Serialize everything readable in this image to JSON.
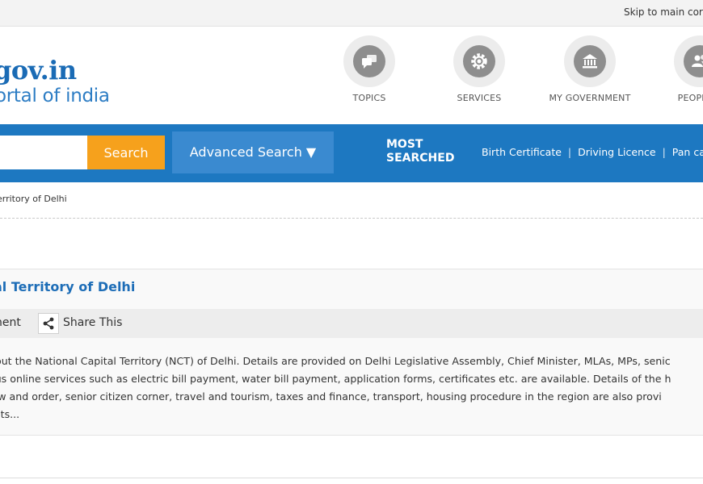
{
  "skip_link": "Skip to main cor",
  "logo": {
    "main": "gov.in",
    "sub": "ortal of india"
  },
  "nav": [
    {
      "label": "TOPICS",
      "icon": "topics-icon"
    },
    {
      "label": "SERVICES",
      "icon": "services-icon"
    },
    {
      "label": "MY GOVERNMENT",
      "icon": "government-icon"
    },
    {
      "label": "PEOPLE C",
      "icon": "people-icon"
    }
  ],
  "search": {
    "placeholder": "",
    "button": "Search",
    "advanced": "Advanced Search ▼"
  },
  "most_searched": {
    "line1": "MOST",
    "line2": "SEARCHED"
  },
  "quick_links": [
    "Birth Certificate",
    "Driving Licence",
    "Pan car"
  ],
  "quick_sep": "|",
  "breadcrumb": "erritory of Delhi",
  "article": {
    "title": "al Territory of Delhi",
    "meta_left": "nent",
    "share": "Share This",
    "lines": [
      "bout the National Capital Territory (NCT) of Delhi. Details are provided on Delhi Legislative Assembly, Chief Minister, MLAs, MPs, senic",
      "ous online services such as electric bill payment, water bill payment, application forms, certificates etc. are available. Details of the h",
      "law and order, senior citizen corner, travel and tourism, taxes and finance, transport, housing procedure in the region are also provi",
      " acts..."
    ]
  },
  "colors": {
    "brand_blue": "#1d78c1",
    "search_orange": "#f6a11c",
    "title_blue": "#1d6db7"
  }
}
